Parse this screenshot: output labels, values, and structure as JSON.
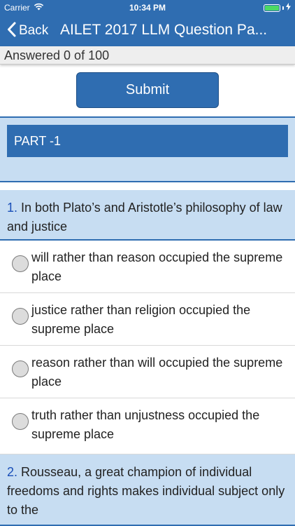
{
  "status_bar": {
    "carrier": "Carrier",
    "time": "10:34 PM",
    "battery_level": 1.0,
    "icons": [
      "wifi-icon",
      "battery-icon",
      "charging-bolt-icon"
    ]
  },
  "nav": {
    "back_label": "Back",
    "title": "AILET 2017 LLM Question Pa..."
  },
  "progress": {
    "answered_text": "Answered 0 of 100"
  },
  "submit_label": "Submit",
  "part": {
    "title": "PART -1"
  },
  "questions": [
    {
      "number": "1.",
      "text": "In both Plato’s and Aristotle’s philosophy of law and justice",
      "options": [
        "will rather than reason occupied the supreme place",
        "justice rather than religion occupied the supreme place",
        "reason rather than will occupied the supreme place",
        "truth rather than unjustness occupied the supreme place"
      ]
    },
    {
      "number": "2.",
      "text": "Rousseau, a great champion of individual freedoms and rights makes individual subject only to the",
      "options": []
    }
  ],
  "colors": {
    "primary": "#2f6db1",
    "section_bg": "#c7ddf2",
    "question_number": "#1a4fb8",
    "battery_fill": "#4cd964"
  }
}
